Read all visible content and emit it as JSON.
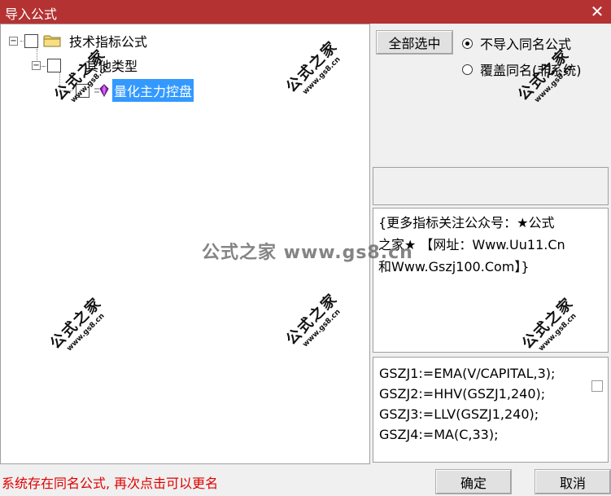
{
  "window": {
    "title": "导入公式",
    "close_glyph": "✕"
  },
  "tree": {
    "root": {
      "label": "技术指标公式",
      "expander": "−",
      "icon": "folder-icon"
    },
    "group": {
      "label": "其他类型",
      "expander": "−"
    },
    "item": {
      "label": "量化主力控盘",
      "icon": "formula-gem-icon",
      "selected": true
    }
  },
  "controls": {
    "select_all_label": "全部选中",
    "radio_no_import": "不导入同名公式",
    "radio_overwrite": "覆盖同名(非系统)",
    "selected_radio": "radio_no_import"
  },
  "description": {
    "lines": [
      "{更多指标关注公众号：★公式",
      "之家★ 【网址：Www.Uu11.Cn",
      "和Www.Gszj100.Com】}"
    ]
  },
  "code": {
    "lines": [
      "GSZJ1:=EMA(V/CAPITAL,3);",
      "GSZJ2:=HHV(GSZJ1,240);",
      "GSZJ3:=LLV(GSZJ1,240);",
      "GSZJ4:=MA(C,33);"
    ]
  },
  "footer": {
    "message": "系统存在同名公式, 再次点击可以更名",
    "ok_label": "确定",
    "cancel_label": "取消"
  },
  "watermark": {
    "big": "公式之家",
    "small": "www.gs8.cn",
    "center": "公式之家 www.gs8.cn"
  },
  "colors": {
    "titlebar": "#b53232",
    "selection": "#3399ff",
    "message": "#e00000"
  }
}
